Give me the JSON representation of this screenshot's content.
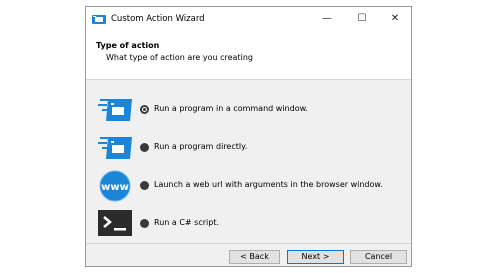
{
  "window": {
    "title": "Custom Action Wizard",
    "controls": {
      "minimize": "—",
      "maximize": "☐",
      "close": "✕"
    }
  },
  "header": {
    "title": "Type of action",
    "subtitle": "What type of action are you creating"
  },
  "options": [
    {
      "label": "Run a program in a command window.",
      "icon": "command-window-icon",
      "selected": true
    },
    {
      "label": "Run a program directly.",
      "icon": "program-icon",
      "selected": false
    },
    {
      "label": "Launch a web url with arguments in the browser window.",
      "icon": "www-globe-icon",
      "selected": false
    },
    {
      "label": "Run a C# script.",
      "icon": "terminal-script-icon",
      "selected": false
    }
  ],
  "buttons": {
    "back": "< Back",
    "next": "Next >",
    "cancel": "Cancel"
  },
  "colors": {
    "accent": "#0a7fd1",
    "window_bg": "#f0f0f0"
  }
}
